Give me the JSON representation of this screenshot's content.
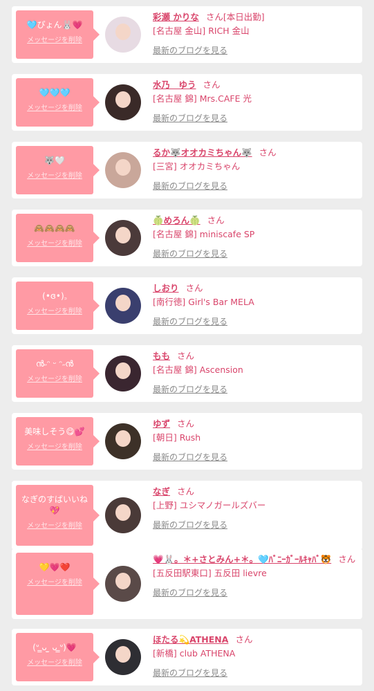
{
  "delete_label": "メッセージを削除",
  "blog_label": "最新のブログを見る",
  "san_label": "さん",
  "colors": {
    "accent": "#d9456b",
    "bubble": "#ff9aa4",
    "background": "#ededed"
  },
  "entries": [
    {
      "message": "🩵ぴょん🐰💗",
      "name": "彩瀬 かりな",
      "suffix": "[本日出勤]",
      "shop": "[名古屋 金山] RICH 金山",
      "avatar_color": "#e7dbe3"
    },
    {
      "message": "🩵🩵🩵",
      "name": "水乃　ゆう",
      "suffix": "",
      "shop": "[名古屋 錦] Mrs.CAFE 光",
      "avatar_color": "#3a2a28"
    },
    {
      "message": "🐺🤍",
      "name": "るか🐺オオカミちゃん🐺",
      "suffix": "",
      "shop": "[三宮] オオカミちゃん",
      "avatar_color": "#c9a79a"
    },
    {
      "message": "🙈🙈🙈🙈",
      "name": "🍈めろん🍈",
      "suffix": "",
      "shop": "[名古屋 錦] miniscafe SP",
      "avatar_color": "#4b3a3a"
    },
    {
      "message": "(•ɞ•)꜆",
      "name": "しおり",
      "suffix": "",
      "shop": "[南行徳] Girl's Bar MELA",
      "avatar_color": "#3a3f6e"
    },
    {
      "message": "ൻ˶ᵔ ᵕ ᵔ˶ൻ",
      "name": "もも",
      "suffix": "",
      "shop": "[名古屋 錦] Ascension",
      "avatar_color": "#3a2630"
    },
    {
      "message": "美味しそう😋💕",
      "name": "ゆず",
      "suffix": "",
      "shop": "[朝日] Rush",
      "avatar_color": "#3d3128"
    },
    {
      "message": "なぎのすばいいね💖",
      "name": "なぎ",
      "suffix": "",
      "shop": "[上野] ユシマノガールズバー",
      "avatar_color": "#4a3a38"
    },
    {
      "message": "💛💗❤️",
      "name": "💗🐰。＊+さとみん+＊。🩵ﾊﾞﾆｰｶﾞｰﾙｷｬﾊﾞ🐯",
      "suffix": "",
      "shop": "[五反田駅東口] 五反田 lievre",
      "avatar_color": "#5a4a48"
    },
    {
      "message": "(ᐡ ̳ᴗ ̫ ᴗ ̳ᐡ)💗",
      "name": "ほたる💫ATHENA",
      "suffix": "",
      "shop": "[新橋] club ATHENA",
      "avatar_color": "#2e2e33"
    }
  ]
}
